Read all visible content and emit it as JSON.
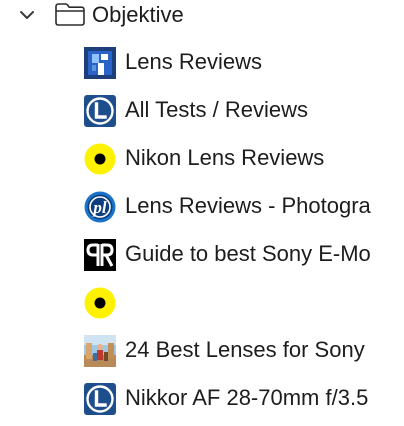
{
  "folder": {
    "label": "Objektive",
    "chevron_icon": "chevron-down-icon",
    "folder_icon": "folder-icon"
  },
  "bookmarks": [
    {
      "label": "Lens Reviews",
      "icon": "blue-lens-logo-icon"
    },
    {
      "label": "All Tests / Reviews",
      "icon": "lenstip-l-icon"
    },
    {
      "label": "Nikon Lens Reviews",
      "icon": "yellow-dot-favicon-icon"
    },
    {
      "label": "Lens Reviews - Photogra",
      "icon": "photography-life-icon"
    },
    {
      "label": "Guide to best Sony E-Mo",
      "icon": "pr-logo-icon"
    },
    {
      "label": "",
      "icon": "yellow-dot-favicon-icon"
    },
    {
      "label": "24 Best Lenses for Sony",
      "icon": "photo-thumbnail-icon"
    },
    {
      "label": "Nikkor AF 28-70mm f/3.5",
      "icon": "lenstip-l-icon"
    }
  ],
  "colors": {
    "text": "#1d1d1f",
    "chevron": "#3a3a3c",
    "yellow": "#fff200",
    "lenstip_blue": "#1f4e8c",
    "photolife_blue": "#1a73c9",
    "lensrev_blue": "#2b64c8"
  }
}
